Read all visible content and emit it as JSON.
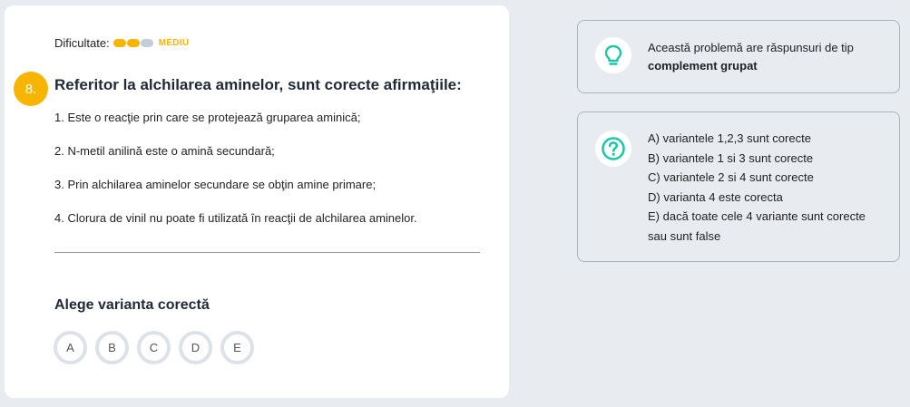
{
  "difficulty": {
    "label": "Dificultate:",
    "level": "MEDIU",
    "pips_on": 2,
    "pips_total": 3
  },
  "question": {
    "number": "8.",
    "title": "Referitor la alchilarea aminelor, sunt corecte afirmaţiile:",
    "statements": [
      "1. Este o reacţie prin care se protejează gruparea aminică;",
      "2. N-metil anilină este o amină secundară;",
      "3. Prin alchilarea aminelor secundare se obţin amine primare;",
      "4. Clorura de vinil nu poate fi utilizată în reacţii de alchilarea aminelor."
    ]
  },
  "answer": {
    "heading": "Alege varianta corectă",
    "options": [
      "A",
      "B",
      "C",
      "D",
      "E"
    ]
  },
  "info_panel": {
    "icon": "lightbulb-icon",
    "line1": "Această problemă are răspunsuri de tip",
    "line2": "complement grupat"
  },
  "legend_panel": {
    "icon": "question-circle-icon",
    "lines": [
      "A) variantele 1,2,3 sunt corecte",
      "B) variantele 1 si 3 sunt corecte",
      "C) variantele 2 si 4 sunt corecte",
      "D) varianta 4 este corecta",
      "E) dacă toate cele 4 variante sunt corecte",
      "sau sunt false"
    ]
  },
  "colors": {
    "accent": "#f7b500",
    "teal": "#1fc7a8",
    "background": "#e8ebf0"
  }
}
